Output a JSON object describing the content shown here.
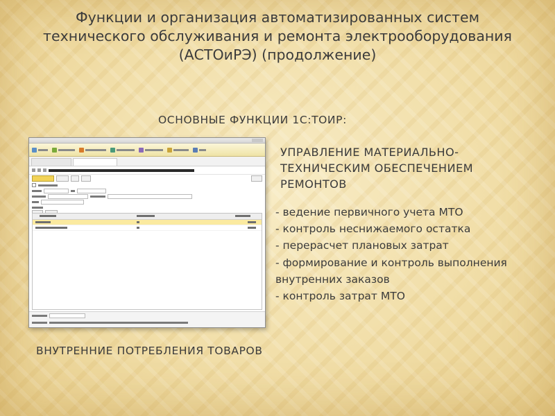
{
  "slide": {
    "title_lines": [
      "Функции и организация автоматизированных систем",
      "технического обслуживания и ремонта электрооборудования",
      "(АСТОиРЭ) (продолжение)"
    ],
    "section_heading": "ОСНОВНЫЕ ФУНКЦИИ 1С:ТОИР:",
    "subheading_lines": [
      "УПРАВЛЕНИЕ МАТЕРИАЛЬНО-",
      "ТЕХНИЧЕСКИМ ОБЕСПЕЧЕНИЕМ",
      "РЕМОНТОВ"
    ],
    "bullets": [
      "- ведение первичного учета МТО",
      "- контроль неснижаемого остатка",
      "- перерасчет плановых затрат",
      "- формирование и контроль выполнения внутренних заказов",
      "- контроль затрат МТО"
    ],
    "bottom_heading": "ВНУТРЕННИЕ ПОТРЕБЛЕНИЯ ТОВАРОВ"
  },
  "colors": {
    "background": "#f3e3b4",
    "text": "#3b3b3b",
    "toolbar_yellow": "#efe3a6",
    "selected_row": "#fbeaa0",
    "primary_button": "#f2d357"
  }
}
